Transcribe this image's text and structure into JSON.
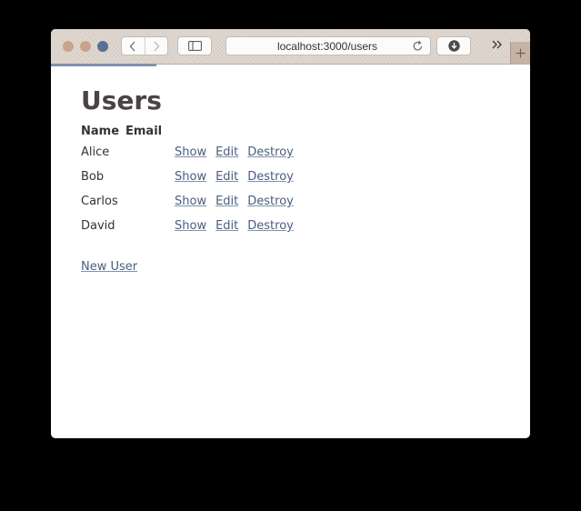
{
  "browser": {
    "address": "localhost:3000/users",
    "icons": {
      "back": "chevron-left-icon",
      "forward": "chevron-right-icon",
      "sidebar": "sidebar-icon",
      "reload": "reload-icon",
      "download": "download-icon",
      "more": "double-chevron-right-icon",
      "new_tab": "plus-icon"
    },
    "colors": {
      "toolbar": "#ddd5cd",
      "progress": "#7d93ae"
    },
    "load_progress": 0.22
  },
  "page": {
    "title": "Users",
    "table": {
      "headers": [
        "Name",
        "Email"
      ],
      "rows": [
        {
          "name": "Alice",
          "email": "",
          "actions": [
            "Show",
            "Edit",
            "Destroy"
          ]
        },
        {
          "name": "Bob",
          "email": "",
          "actions": [
            "Show",
            "Edit",
            "Destroy"
          ]
        },
        {
          "name": "Carlos",
          "email": "",
          "actions": [
            "Show",
            "Edit",
            "Destroy"
          ]
        },
        {
          "name": "David",
          "email": "",
          "actions": [
            "Show",
            "Edit",
            "Destroy"
          ]
        }
      ]
    },
    "new_user_link": "New User"
  }
}
